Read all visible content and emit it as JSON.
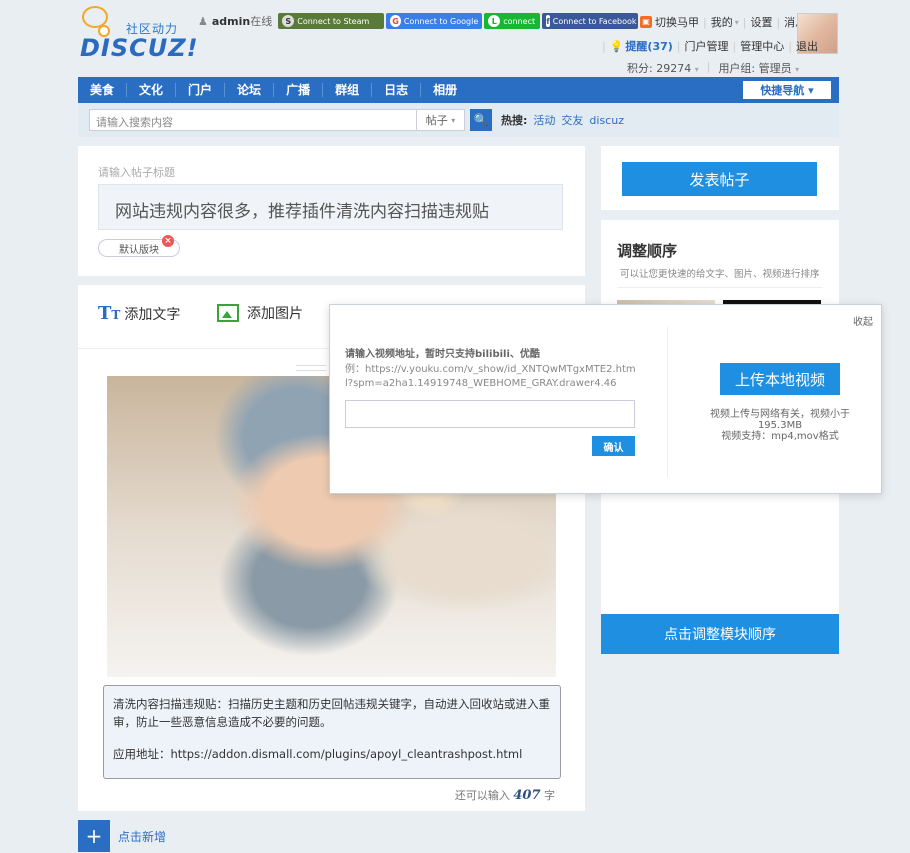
{
  "header": {
    "slogan": "社区动力",
    "logo_text": "DISCUZ!",
    "username": "admin",
    "online": "在线",
    "connect": {
      "steam": "Connect to Steam",
      "google": "Connect to Google",
      "line": "connect",
      "facebook": "Connect to Facebook"
    },
    "links": [
      "切换马甲",
      "我的",
      "设置",
      "消息"
    ],
    "remind": "提醒(37)",
    "row2_links": [
      "门户管理",
      "管理中心",
      "退出"
    ],
    "credits": "积分: 29274",
    "usergroup": "用户组: 管理员"
  },
  "nav": {
    "items": [
      "美食",
      "文化",
      "门户",
      "论坛",
      "广播",
      "群组",
      "日志",
      "相册"
    ],
    "quick": "快捷导航"
  },
  "search": {
    "placeholder": "请输入搜索内容",
    "type": "帖子",
    "hot_label": "热搜:",
    "hot_links": [
      "活动",
      "交友",
      "discuz"
    ]
  },
  "title_panel": {
    "label": "请输入帖子标题",
    "value": "网站违规内容很多，推荐插件清洗内容扫描违规贴",
    "tag": "默认版块",
    "remove": "×"
  },
  "editor": {
    "add_text": "添加文字",
    "add_image": "添加图片",
    "description_line1": "清洗内容扫描违规贴：扫描历史主题和历史回帖违规关键字，自动进入回收站或进入重审，防止一些恶意信息造成不必要的问题。",
    "description_line2": "应用地址：https://addon.dismall.com/plugins/apoyl_cleantrashpost.html",
    "counter_prefix": "还可以输入",
    "counter_value": "407",
    "counter_suffix": "字"
  },
  "add_new": {
    "label": "点击新增",
    "icon": "+"
  },
  "sidebar": {
    "post_button": "发表帖子",
    "order_title": "调整顺序",
    "order_subtitle": "可以让您更快速的给文字、图片、视频进行排序",
    "order_button": "点击调整模块顺序"
  },
  "popup": {
    "collapse": "收起",
    "label": "请输入视频地址，暂时只支持bilibili、优酷",
    "example": "例：https://v.youku.com/v_show/id_XNTQwMTgxMTE2.html?spm=a2ha1.14919748_WEBHOME_GRAY.drawer4.46",
    "ok": "确认",
    "upload": "上传本地视频",
    "hint1": "视频上传与网络有关，视频小于 195.3MB",
    "hint2": "视频支持：mp4,mov格式"
  }
}
